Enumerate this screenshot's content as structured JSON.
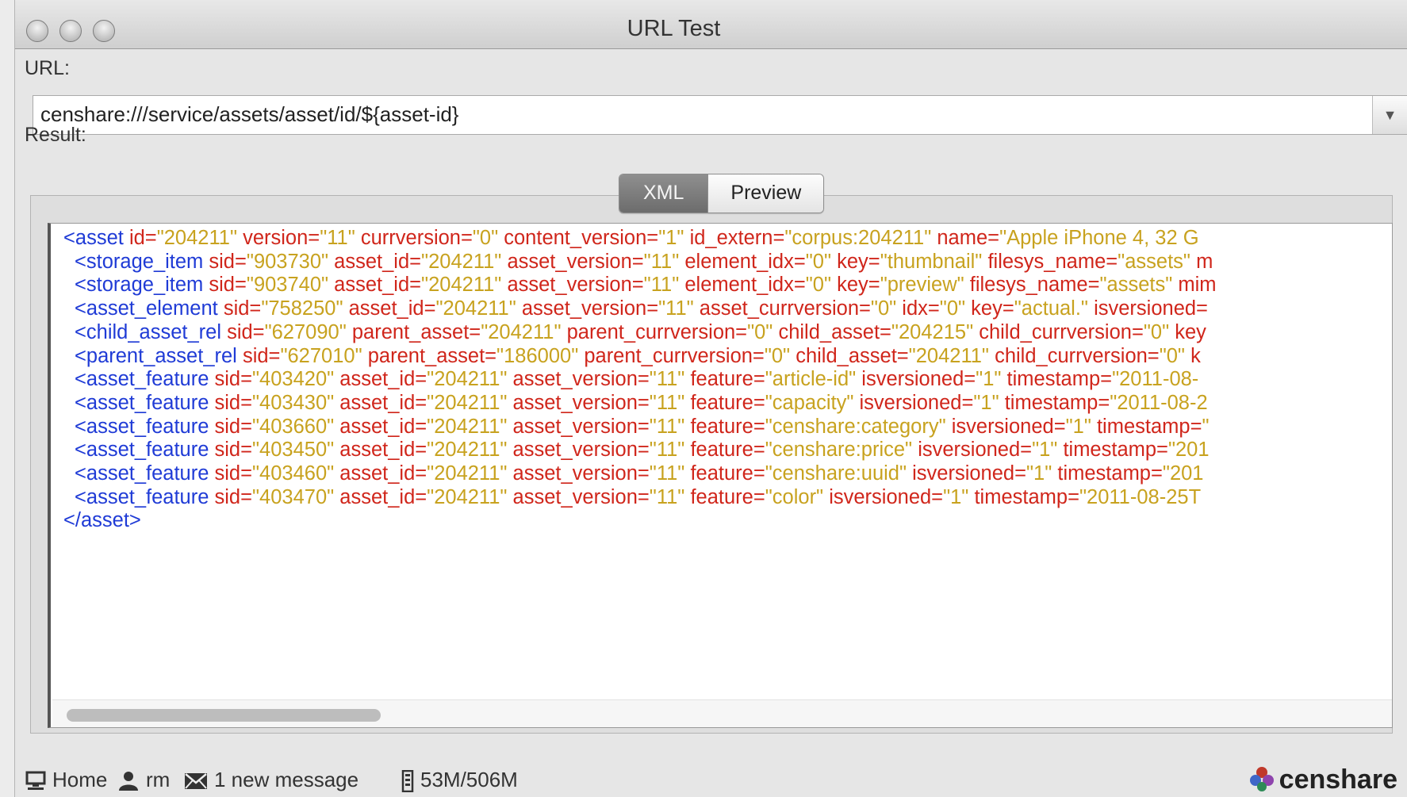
{
  "window": {
    "title": "URL Test"
  },
  "url_label": "URL:",
  "url_value": "censhare:///service/assets/asset/id/${asset-id}",
  "result_label": "Result:",
  "tabs": [
    {
      "label": "XML",
      "active": true
    },
    {
      "label": "Preview",
      "active": false
    }
  ],
  "xml_lines": [
    {
      "indent": 0,
      "parts": [
        {
          "k": "t",
          "s": "<asset "
        },
        {
          "k": "a",
          "s": "id="
        },
        {
          "k": "v",
          "s": "\"204211\" "
        },
        {
          "k": "a",
          "s": "version="
        },
        {
          "k": "v",
          "s": "\"11\" "
        },
        {
          "k": "a",
          "s": "currversion="
        },
        {
          "k": "v",
          "s": "\"0\" "
        },
        {
          "k": "a",
          "s": "content_version="
        },
        {
          "k": "v",
          "s": "\"1\" "
        },
        {
          "k": "a",
          "s": "id_extern="
        },
        {
          "k": "v",
          "s": "\"corpus:204211\" "
        },
        {
          "k": "a",
          "s": "name="
        },
        {
          "k": "v",
          "s": "\"Apple iPhone 4, 32 G"
        }
      ]
    },
    {
      "indent": 1,
      "parts": [
        {
          "k": "t",
          "s": "<storage_item "
        },
        {
          "k": "a",
          "s": "sid="
        },
        {
          "k": "v",
          "s": "\"903730\" "
        },
        {
          "k": "a",
          "s": "asset_id="
        },
        {
          "k": "v",
          "s": "\"204211\" "
        },
        {
          "k": "a",
          "s": "asset_version="
        },
        {
          "k": "v",
          "s": "\"11\" "
        },
        {
          "k": "a",
          "s": "element_idx="
        },
        {
          "k": "v",
          "s": "\"0\" "
        },
        {
          "k": "a",
          "s": "key="
        },
        {
          "k": "v",
          "s": "\"thumbnail\" "
        },
        {
          "k": "a",
          "s": "filesys_name="
        },
        {
          "k": "v",
          "s": "\"assets\" "
        },
        {
          "k": "a",
          "s": "m"
        }
      ]
    },
    {
      "indent": 1,
      "parts": [
        {
          "k": "t",
          "s": "<storage_item "
        },
        {
          "k": "a",
          "s": "sid="
        },
        {
          "k": "v",
          "s": "\"903740\" "
        },
        {
          "k": "a",
          "s": "asset_id="
        },
        {
          "k": "v",
          "s": "\"204211\" "
        },
        {
          "k": "a",
          "s": "asset_version="
        },
        {
          "k": "v",
          "s": "\"11\" "
        },
        {
          "k": "a",
          "s": "element_idx="
        },
        {
          "k": "v",
          "s": "\"0\" "
        },
        {
          "k": "a",
          "s": "key="
        },
        {
          "k": "v",
          "s": "\"preview\" "
        },
        {
          "k": "a",
          "s": "filesys_name="
        },
        {
          "k": "v",
          "s": "\"assets\" "
        },
        {
          "k": "a",
          "s": "mim"
        }
      ]
    },
    {
      "indent": 1,
      "parts": [
        {
          "k": "t",
          "s": "<asset_element "
        },
        {
          "k": "a",
          "s": "sid="
        },
        {
          "k": "v",
          "s": "\"758250\" "
        },
        {
          "k": "a",
          "s": "asset_id="
        },
        {
          "k": "v",
          "s": "\"204211\" "
        },
        {
          "k": "a",
          "s": "asset_version="
        },
        {
          "k": "v",
          "s": "\"11\" "
        },
        {
          "k": "a",
          "s": "asset_currversion="
        },
        {
          "k": "v",
          "s": "\"0\" "
        },
        {
          "k": "a",
          "s": "idx="
        },
        {
          "k": "v",
          "s": "\"0\" "
        },
        {
          "k": "a",
          "s": "key="
        },
        {
          "k": "v",
          "s": "\"actual.\" "
        },
        {
          "k": "a",
          "s": "isversioned="
        }
      ]
    },
    {
      "indent": 1,
      "parts": [
        {
          "k": "t",
          "s": "<child_asset_rel "
        },
        {
          "k": "a",
          "s": "sid="
        },
        {
          "k": "v",
          "s": "\"627090\" "
        },
        {
          "k": "a",
          "s": "parent_asset="
        },
        {
          "k": "v",
          "s": "\"204211\" "
        },
        {
          "k": "a",
          "s": "parent_currversion="
        },
        {
          "k": "v",
          "s": "\"0\" "
        },
        {
          "k": "a",
          "s": "child_asset="
        },
        {
          "k": "v",
          "s": "\"204215\" "
        },
        {
          "k": "a",
          "s": "child_currversion="
        },
        {
          "k": "v",
          "s": "\"0\" "
        },
        {
          "k": "a",
          "s": "key"
        }
      ]
    },
    {
      "indent": 1,
      "parts": [
        {
          "k": "t",
          "s": "<parent_asset_rel "
        },
        {
          "k": "a",
          "s": "sid="
        },
        {
          "k": "v",
          "s": "\"627010\" "
        },
        {
          "k": "a",
          "s": "parent_asset="
        },
        {
          "k": "v",
          "s": "\"186000\" "
        },
        {
          "k": "a",
          "s": "parent_currversion="
        },
        {
          "k": "v",
          "s": "\"0\" "
        },
        {
          "k": "a",
          "s": "child_asset="
        },
        {
          "k": "v",
          "s": "\"204211\" "
        },
        {
          "k": "a",
          "s": "child_currversion="
        },
        {
          "k": "v",
          "s": "\"0\" "
        },
        {
          "k": "a",
          "s": "k"
        }
      ]
    },
    {
      "indent": 1,
      "parts": [
        {
          "k": "t",
          "s": "<asset_feature "
        },
        {
          "k": "a",
          "s": "sid="
        },
        {
          "k": "v",
          "s": "\"403420\" "
        },
        {
          "k": "a",
          "s": "asset_id="
        },
        {
          "k": "v",
          "s": "\"204211\" "
        },
        {
          "k": "a",
          "s": "asset_version="
        },
        {
          "k": "v",
          "s": "\"11\" "
        },
        {
          "k": "a",
          "s": "feature="
        },
        {
          "k": "v",
          "s": "\"article-id\" "
        },
        {
          "k": "a",
          "s": "isversioned="
        },
        {
          "k": "v",
          "s": "\"1\" "
        },
        {
          "k": "a",
          "s": "timestamp="
        },
        {
          "k": "v",
          "s": "\"2011-08-"
        }
      ]
    },
    {
      "indent": 1,
      "parts": [
        {
          "k": "t",
          "s": "<asset_feature "
        },
        {
          "k": "a",
          "s": "sid="
        },
        {
          "k": "v",
          "s": "\"403430\" "
        },
        {
          "k": "a",
          "s": "asset_id="
        },
        {
          "k": "v",
          "s": "\"204211\" "
        },
        {
          "k": "a",
          "s": "asset_version="
        },
        {
          "k": "v",
          "s": "\"11\" "
        },
        {
          "k": "a",
          "s": "feature="
        },
        {
          "k": "v",
          "s": "\"capacity\" "
        },
        {
          "k": "a",
          "s": "isversioned="
        },
        {
          "k": "v",
          "s": "\"1\" "
        },
        {
          "k": "a",
          "s": "timestamp="
        },
        {
          "k": "v",
          "s": "\"2011-08-2"
        }
      ]
    },
    {
      "indent": 1,
      "parts": [
        {
          "k": "t",
          "s": "<asset_feature "
        },
        {
          "k": "a",
          "s": "sid="
        },
        {
          "k": "v",
          "s": "\"403660\" "
        },
        {
          "k": "a",
          "s": "asset_id="
        },
        {
          "k": "v",
          "s": "\"204211\" "
        },
        {
          "k": "a",
          "s": "asset_version="
        },
        {
          "k": "v",
          "s": "\"11\" "
        },
        {
          "k": "a",
          "s": "feature="
        },
        {
          "k": "v",
          "s": "\"censhare:category\" "
        },
        {
          "k": "a",
          "s": "isversioned="
        },
        {
          "k": "v",
          "s": "\"1\" "
        },
        {
          "k": "a",
          "s": "timestamp="
        },
        {
          "k": "v",
          "s": "\""
        }
      ]
    },
    {
      "indent": 1,
      "parts": [
        {
          "k": "t",
          "s": "<asset_feature "
        },
        {
          "k": "a",
          "s": "sid="
        },
        {
          "k": "v",
          "s": "\"403450\" "
        },
        {
          "k": "a",
          "s": "asset_id="
        },
        {
          "k": "v",
          "s": "\"204211\" "
        },
        {
          "k": "a",
          "s": "asset_version="
        },
        {
          "k": "v",
          "s": "\"11\" "
        },
        {
          "k": "a",
          "s": "feature="
        },
        {
          "k": "v",
          "s": "\"censhare:price\" "
        },
        {
          "k": "a",
          "s": "isversioned="
        },
        {
          "k": "v",
          "s": "\"1\" "
        },
        {
          "k": "a",
          "s": "timestamp="
        },
        {
          "k": "v",
          "s": "\"201"
        }
      ]
    },
    {
      "indent": 1,
      "parts": [
        {
          "k": "t",
          "s": "<asset_feature "
        },
        {
          "k": "a",
          "s": "sid="
        },
        {
          "k": "v",
          "s": "\"403460\" "
        },
        {
          "k": "a",
          "s": "asset_id="
        },
        {
          "k": "v",
          "s": "\"204211\" "
        },
        {
          "k": "a",
          "s": "asset_version="
        },
        {
          "k": "v",
          "s": "\"11\" "
        },
        {
          "k": "a",
          "s": "feature="
        },
        {
          "k": "v",
          "s": "\"censhare:uuid\" "
        },
        {
          "k": "a",
          "s": "isversioned="
        },
        {
          "k": "v",
          "s": "\"1\" "
        },
        {
          "k": "a",
          "s": "timestamp="
        },
        {
          "k": "v",
          "s": "\"201"
        }
      ]
    },
    {
      "indent": 1,
      "parts": [
        {
          "k": "t",
          "s": "<asset_feature "
        },
        {
          "k": "a",
          "s": "sid="
        },
        {
          "k": "v",
          "s": "\"403470\" "
        },
        {
          "k": "a",
          "s": "asset_id="
        },
        {
          "k": "v",
          "s": "\"204211\" "
        },
        {
          "k": "a",
          "s": "asset_version="
        },
        {
          "k": "v",
          "s": "\"11\" "
        },
        {
          "k": "a",
          "s": "feature="
        },
        {
          "k": "v",
          "s": "\"color\" "
        },
        {
          "k": "a",
          "s": "isversioned="
        },
        {
          "k": "v",
          "s": "\"1\" "
        },
        {
          "k": "a",
          "s": "timestamp="
        },
        {
          "k": "v",
          "s": "\"2011-08-25T"
        }
      ]
    },
    {
      "indent": 0,
      "parts": [
        {
          "k": "t",
          "s": "</asset>"
        }
      ]
    }
  ],
  "status": {
    "home": "Home",
    "user": "rm",
    "messages": "1 new message",
    "memory": "53M/506M",
    "brand": "censhare"
  },
  "colors": {
    "tag": "#1f3bd6",
    "attribute": "#d0261b",
    "value": "#c8a21f",
    "logo_mark": [
      "#c0392b",
      "#3f66c7",
      "#8e44ad",
      "#2e8b57"
    ]
  }
}
